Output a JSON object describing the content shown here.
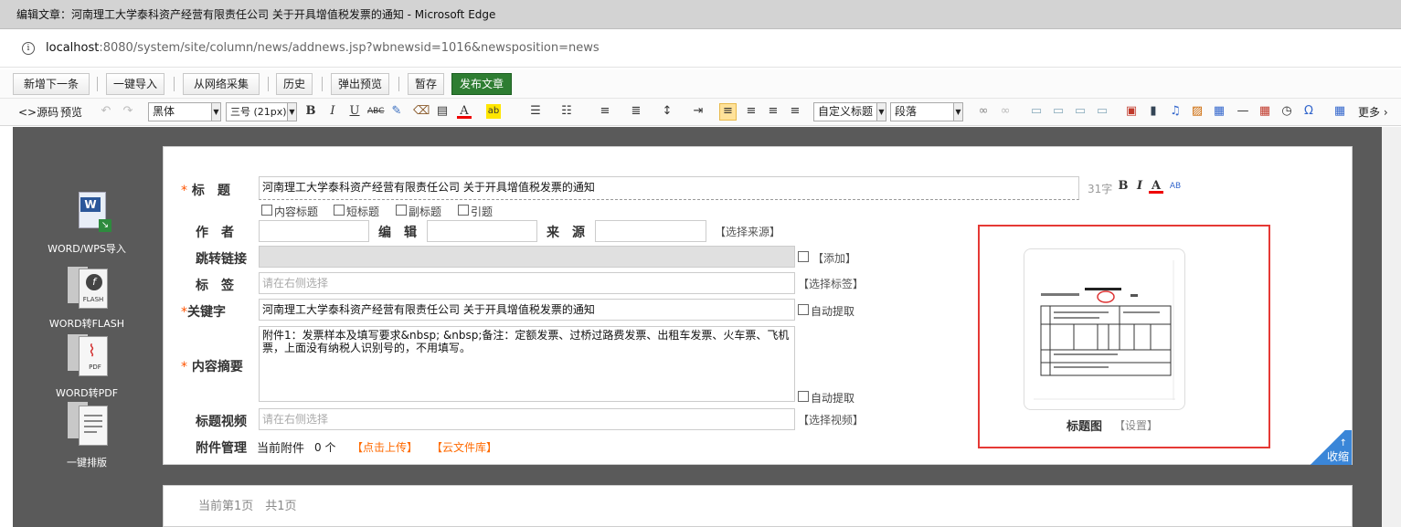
{
  "window": {
    "title": "编辑文章：河南理工大学泰科资产经营有限责任公司 关于开具增值税发票的通知 - Microsoft Edge"
  },
  "address": {
    "host": "localhost",
    "path": ":8080/system/site/column/news/addnews.jsp?wbnewsid=1016&newsposition=news"
  },
  "actions": [
    "新增下一条",
    "一键导入",
    "从网络采集",
    "历史",
    "弹出预览",
    "暂存",
    "发布文章"
  ],
  "editor_toolbar": {
    "source": "源码",
    "preview": "预览",
    "font_family": "黑体",
    "font_size": "三号 (21px)",
    "heading_style": "自定义标题",
    "paragraph": "段落",
    "more": "更多"
  },
  "sidebar_tools": [
    "WORD/WPS导入",
    "WORD转FLASH",
    "WORD转PDF",
    "一键排版"
  ],
  "form": {
    "title_label": "标　题",
    "title_value": "河南理工大学泰科资产经营有限责任公司 关于开具增值税发票的通知",
    "char_count": "31字",
    "title_checks": [
      "内容标题",
      "短标题",
      "副标题",
      "引题"
    ],
    "author_label": "作　者",
    "editor_label": "编　辑",
    "source_label": "来　源",
    "choose_source": "【选择来源】",
    "redirect_label": "跳转链接",
    "add_label": "【添加】",
    "tags_label": "标　签",
    "tags_placeholder": "请在右侧选择",
    "choose_tags": "【选择标签】",
    "keywords_label": "关键字",
    "keywords_value": "河南理工大学泰科资产经营有限责任公司 关于开具增值税发票的通知",
    "auto_extract": "自动提取",
    "summary_label": "内容摘要",
    "summary_value": "附件1：发票样本及填写要求&nbsp; &nbsp;备注：定额发票、过桥过路费发票、出租车发票、火车票、飞机票，上面没有纳税人识别号的，不用填写。",
    "video_label": "标题视频",
    "video_placeholder": "请在右侧选择",
    "choose_video": "【选择视频】",
    "attachment_label": "附件管理",
    "attachment_current": "当前附件",
    "attachment_count": "0 个",
    "upload_link": "【点击上传】",
    "cloud_link": "【云文件库】",
    "title_image_label": "标题图",
    "title_image_setting": "【设置】",
    "collapse": "收缩"
  },
  "pager": {
    "text": "当前第1页　共1页"
  }
}
